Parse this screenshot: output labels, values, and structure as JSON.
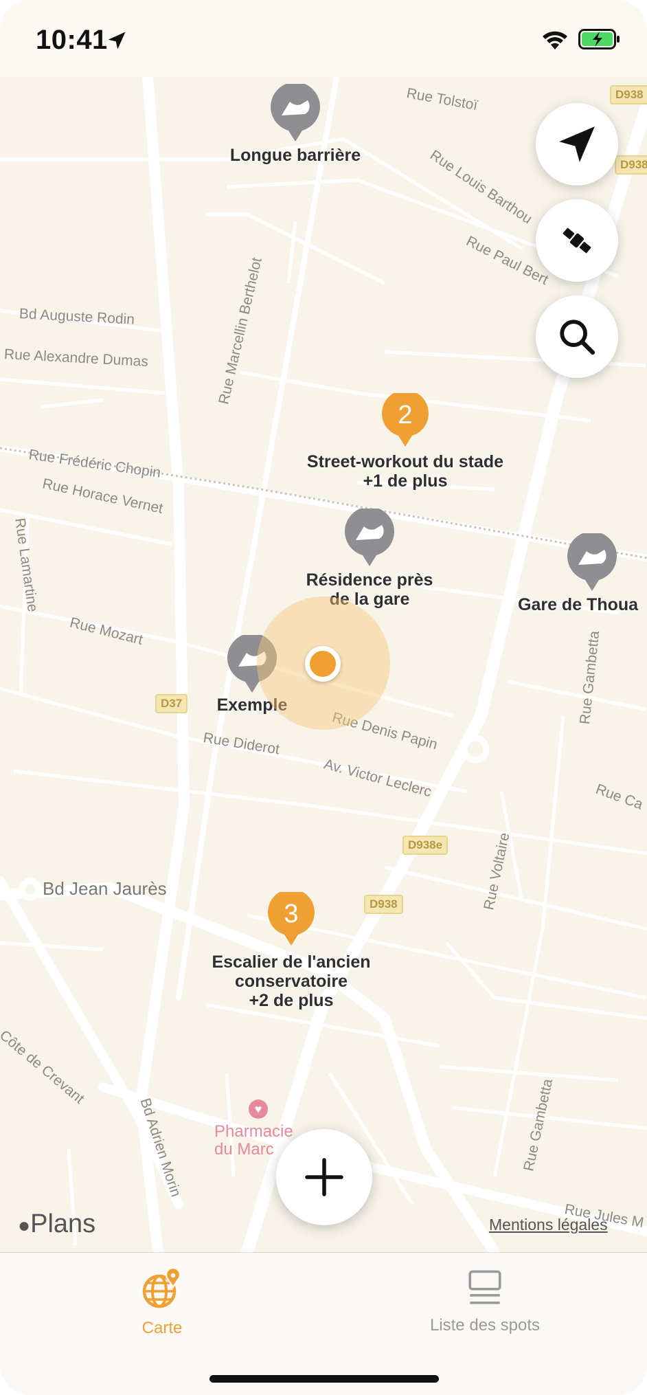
{
  "status_bar": {
    "time": "10:41"
  },
  "map": {
    "streets": [
      "Rue Tolstoï",
      "Rue Louis Barthou",
      "Rue Paul Bert",
      "Rue Marcellin Berthelot",
      "Bd Auguste Rodin",
      "Rue Alexandre Dumas",
      "Rue Frédéric Chopin",
      "Rue Horace Vernet",
      "Rue Lamartine",
      "Rue Mozart",
      "Rue Denis Papin",
      "Rue Diderot",
      "Av. Victor Leclerc",
      "Rue Gambetta",
      "Rue Ca",
      "Rue Voltaire",
      "Bd Jean Jaurès",
      "Côte de Crevant",
      "Bd Adrien Morin",
      "Rue Gambetta",
      "Rue Jules M"
    ],
    "road_shields": [
      "D938",
      "D938",
      "D37",
      "D938e",
      "D938"
    ],
    "spots": [
      {
        "label": "Longue barrière"
      },
      {
        "label_line1": "Résidence près",
        "label_line2": "de la gare"
      },
      {
        "label": "Gare de Thoua"
      },
      {
        "label": "Exemple"
      }
    ],
    "clusters": [
      {
        "count": "2",
        "line1": "Street-workout du stade",
        "line2": "+1 de plus"
      },
      {
        "count": "3",
        "line1": "Escalier de l'ancien",
        "line2": "conservatoire",
        "line3": "+2 de plus"
      }
    ],
    "poi": {
      "line1": "Pharmacie",
      "line2": "du Marc"
    },
    "attribution": {
      "brand": "Plans",
      "legal": "Mentions légales"
    }
  },
  "buttons": {
    "locate_icon": "location-arrow-icon",
    "satellite_icon": "satellite-icon",
    "search_icon": "search-icon",
    "add_icon": "plus-icon"
  },
  "tabbar": {
    "tabs": [
      {
        "label": "Carte",
        "active": true,
        "icon": "globe-pin-icon"
      },
      {
        "label": "Liste des spots",
        "active": false,
        "icon": "list-icon"
      }
    ]
  },
  "colors": {
    "accent": "#f0a033",
    "pin_gray": "#8e8e93",
    "map_bg": "#f8f4ea"
  }
}
